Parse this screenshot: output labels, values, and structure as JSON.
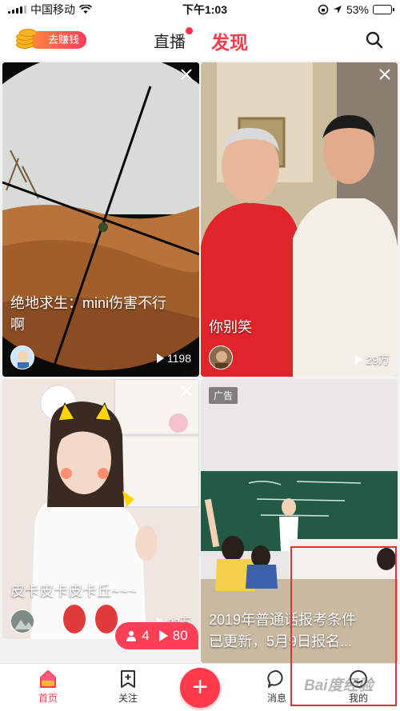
{
  "status_bar": {
    "carrier": "中国移动",
    "time": "下午1:03",
    "battery": "53%",
    "battery_level": 0.53
  },
  "header": {
    "earn_label": "去赚钱",
    "tab_live": "直播",
    "tab_discover": "发现"
  },
  "cards": [
    {
      "title_line1": "绝地求生：mini伤害不行",
      "title_line2": "啊",
      "plays": "1198"
    },
    {
      "title_line1": "你别笑",
      "plays": "29万"
    },
    {
      "title_line1": "皮卡皮卡皮卡丘~~~",
      "plays": "22万"
    },
    {
      "ad_label": "广告",
      "title_line1": "2019年普通话报考条件",
      "title_line2": "已更新，5月9日报名..."
    }
  ],
  "live_bubble": {
    "viewers": "4",
    "plays": "80"
  },
  "bottom_nav": {
    "home": "首页",
    "follow": "关注",
    "messages": "消息",
    "me": "我的"
  },
  "watermark": "Bai度经验",
  "colors": {
    "accent": "#ff3a4a",
    "highlight_box": "#e5302f"
  }
}
